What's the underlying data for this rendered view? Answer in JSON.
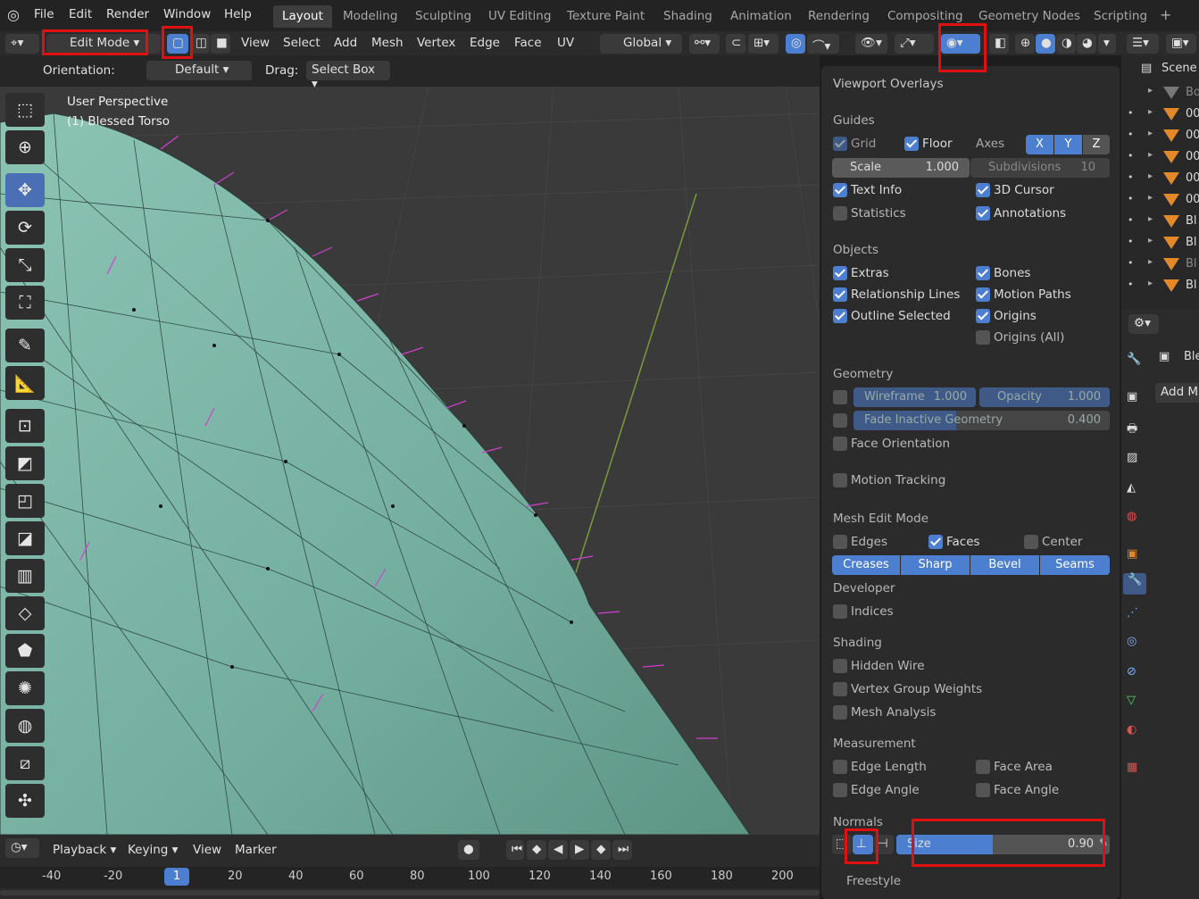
{
  "menu": [
    "File",
    "Edit",
    "Render",
    "Window",
    "Help"
  ],
  "workspaces": [
    "Layout",
    "Modeling",
    "Sculpting",
    "UV Editing",
    "Texture Paint",
    "Shading",
    "Animation",
    "Rendering",
    "Compositing",
    "Geometry Nodes",
    "Scripting"
  ],
  "active_workspace": "Layout",
  "header": {
    "mode": "Edit Mode",
    "menus": [
      "View",
      "Select",
      "Add",
      "Mesh",
      "Vertex",
      "Edge",
      "Face",
      "UV"
    ],
    "transform": "Global"
  },
  "subheader": {
    "orientation_label": "Orientation:",
    "orientation_value": "Default",
    "drag_label": "Drag:",
    "drag_value": "Select Box"
  },
  "viewport": {
    "line1": "User Perspective",
    "line2": "(1) Blessed Torso"
  },
  "overlays": {
    "title": "Viewport Overlays",
    "guides": {
      "heading": "Guides",
      "grid": "Grid",
      "floor": "Floor",
      "axes": "Axes",
      "x": "X",
      "y": "Y",
      "z": "Z",
      "scale_label": "Scale",
      "scale_value": "1.000",
      "subdiv_label": "Subdivisions",
      "subdiv_value": "10",
      "text_info": "Text Info",
      "cursor": "3D Cursor",
      "statistics": "Statistics",
      "annotations": "Annotations"
    },
    "objects": {
      "heading": "Objects",
      "extras": "Extras",
      "bones": "Bones",
      "rel_lines": "Relationship Lines",
      "motion_paths": "Motion Paths",
      "outline": "Outline Selected",
      "origins": "Origins",
      "origins_all": "Origins (All)"
    },
    "geometry": {
      "heading": "Geometry",
      "wireframe": "Wireframe",
      "wireframe_value": "1.000",
      "opacity": "Opacity",
      "opacity_value": "1.000",
      "fade": "Fade Inactive Geometry",
      "fade_value": "0.400",
      "face_orient": "Face Orientation"
    },
    "motion_tracking": "Motion Tracking",
    "mesh_edit": {
      "heading": "Mesh Edit Mode",
      "edges": "Edges",
      "faces": "Faces",
      "center": "Center",
      "creases": "Creases",
      "sharp": "Sharp",
      "bevel": "Bevel",
      "seams": "Seams"
    },
    "developer": {
      "heading": "Developer",
      "indices": "Indices"
    },
    "shading": {
      "heading": "Shading",
      "hidden_wire": "Hidden Wire",
      "vgroup": "Vertex Group Weights",
      "mesh_analysis": "Mesh Analysis"
    },
    "measurement": {
      "heading": "Measurement",
      "edge_length": "Edge Length",
      "face_area": "Face Area",
      "edge_angle": "Edge Angle",
      "face_angle": "Face Angle"
    },
    "normals": {
      "heading": "Normals",
      "size_label": "Size",
      "size_value": "0.90",
      "size_fraction": 0.45
    },
    "freestyle": "Freestyle"
  },
  "outliner": {
    "scene": "Scene",
    "rows": [
      "Bo",
      "00",
      "00",
      "00",
      "00",
      "00",
      "Bl",
      "Bl",
      "Bl",
      "Bl"
    ]
  },
  "props": {
    "object": "Ble",
    "add": "Add M"
  },
  "timeline": {
    "menus": [
      "Playback",
      "Keying",
      "View",
      "Marker"
    ],
    "ticks": [
      "-40",
      "-20",
      "1",
      "20",
      "40",
      "60",
      "80",
      "100",
      "120",
      "140",
      "160",
      "180",
      "200"
    ],
    "current": "1"
  },
  "colors": {
    "accent": "#4d7fd0",
    "highlight": "#e01010",
    "mesh": "#7fb8a8",
    "normals": "#d040d0"
  }
}
